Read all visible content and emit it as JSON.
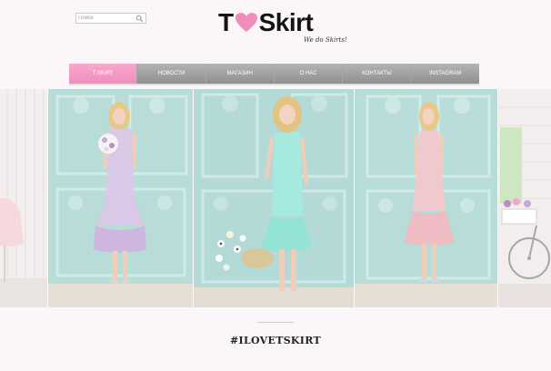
{
  "search": {
    "placeholder": "Поиск"
  },
  "logo": {
    "t": "T",
    "rest": "Skirt",
    "tagline": "We do Skirts!"
  },
  "nav": {
    "items": [
      {
        "label": "T-Skirt",
        "active": true
      },
      {
        "label": "Новости"
      },
      {
        "label": "Магазин"
      },
      {
        "label": "О нас"
      },
      {
        "label": "Контакты"
      },
      {
        "label": "Instagram"
      }
    ]
  },
  "gallery": {
    "photos": [
      {
        "subject": "white wall with chair and tulle skirt"
      },
      {
        "subject": "model in lilac mermaid dress with flowers"
      },
      {
        "subject": "model in mint dress with flower basket"
      },
      {
        "subject": "model in pink ruffle dress"
      },
      {
        "subject": "bicycle with flower basket"
      }
    ]
  },
  "footer": {
    "hashtag": "#ILOVETSKIRT"
  },
  "colors": {
    "accent": "#f08ebb",
    "nav": "#a0a0a0",
    "wall": "#b8dcd8",
    "background": "#fbf7f8"
  }
}
